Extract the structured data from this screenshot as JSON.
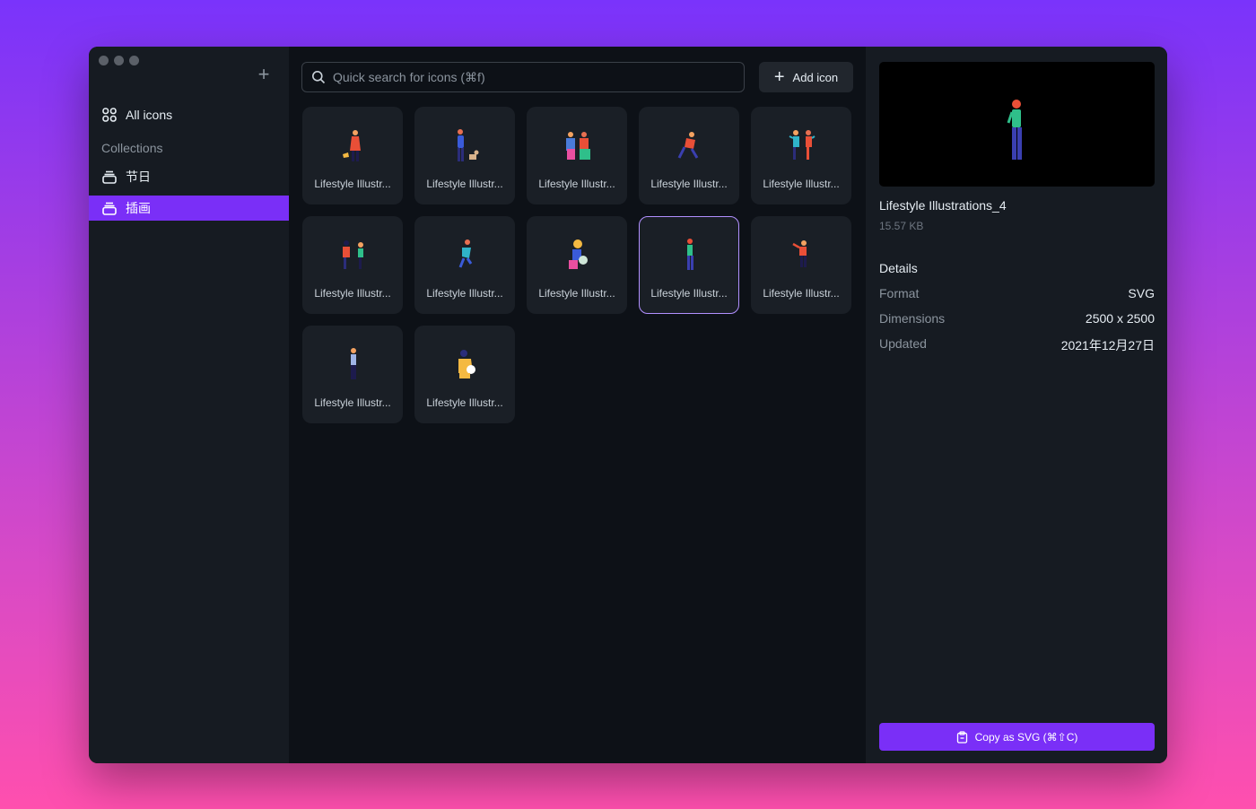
{
  "sidebar": {
    "all_icons_label": "All icons",
    "collections_title": "Collections",
    "collections": [
      {
        "label": "节日"
      },
      {
        "label": "插画"
      }
    ]
  },
  "toolbar": {
    "search_placeholder": "Quick search for icons (⌘f)",
    "add_icon_label": "Add icon"
  },
  "grid": {
    "items": [
      {
        "label": "Lifestyle Illustr..."
      },
      {
        "label": "Lifestyle Illustr..."
      },
      {
        "label": "Lifestyle Illustr..."
      },
      {
        "label": "Lifestyle Illustr..."
      },
      {
        "label": "Lifestyle Illustr..."
      },
      {
        "label": "Lifestyle Illustr..."
      },
      {
        "label": "Lifestyle Illustr..."
      },
      {
        "label": "Lifestyle Illustr..."
      },
      {
        "label": "Lifestyle Illustr..."
      },
      {
        "label": "Lifestyle Illustr..."
      },
      {
        "label": "Lifestyle Illustr..."
      },
      {
        "label": "Lifestyle Illustr..."
      }
    ]
  },
  "detail": {
    "name": "Lifestyle Illustrations_4",
    "size": "15.57 KB",
    "details_title": "Details",
    "format_label": "Format",
    "format_value": "SVG",
    "dimensions_label": "Dimensions",
    "dimensions_value": "2500 x 2500",
    "updated_label": "Updated",
    "updated_value": "2021年12月27日",
    "copy_label": "Copy as SVG (⌘⇧C)"
  },
  "colors": {
    "accent": "#7a2ff7",
    "selected_border": "#b190ff",
    "window_bg": "#0d1117",
    "panel_bg": "#161b22"
  }
}
